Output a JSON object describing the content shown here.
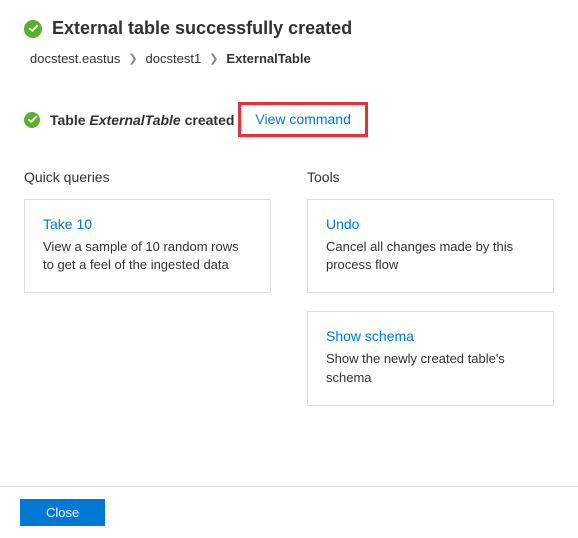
{
  "header": {
    "title": "External table successfully created"
  },
  "breadcrumb": {
    "items": [
      "docstest.eastus",
      "docstest1",
      "ExternalTable"
    ]
  },
  "status": {
    "prefix": "Table ",
    "entity": "ExternalTable",
    "suffix": " created",
    "link_label": "View command"
  },
  "sections": {
    "quick_queries": {
      "title": "Quick queries",
      "cards": [
        {
          "title": "Take 10",
          "desc": "View a sample of 10 random rows to get a feel of the ingested data"
        }
      ]
    },
    "tools": {
      "title": "Tools",
      "cards": [
        {
          "title": "Undo",
          "desc": "Cancel all changes made by this process flow"
        },
        {
          "title": "Show schema",
          "desc": "Show the newly created table's schema"
        }
      ]
    }
  },
  "footer": {
    "close_label": "Close"
  }
}
